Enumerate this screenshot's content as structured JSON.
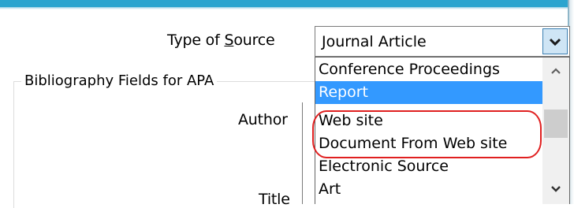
{
  "form": {
    "type_label_pre": "Type of ",
    "type_label_ul": "S",
    "type_label_post": "ource",
    "group_title": "Bibliography Fields for APA",
    "author_label": "Author",
    "title_label": "Title"
  },
  "source_select": {
    "value": "Journal Article",
    "options": [
      "Conference Proceedings",
      "Report",
      "Web site",
      "Document From Web site",
      "Electronic Source",
      "Art"
    ],
    "selected_index": 1,
    "highlighted_options": [
      "Web site",
      "Document From Web site"
    ]
  },
  "icons": {
    "dropdown_arrow": "chevron-down-icon",
    "scroll_up": "chevron-up-icon",
    "scroll_down": "chevron-down-icon"
  },
  "colors": {
    "selection": "#3399ff",
    "annotation_outline": "#e02020",
    "title_bar": "#2aa4cf"
  }
}
